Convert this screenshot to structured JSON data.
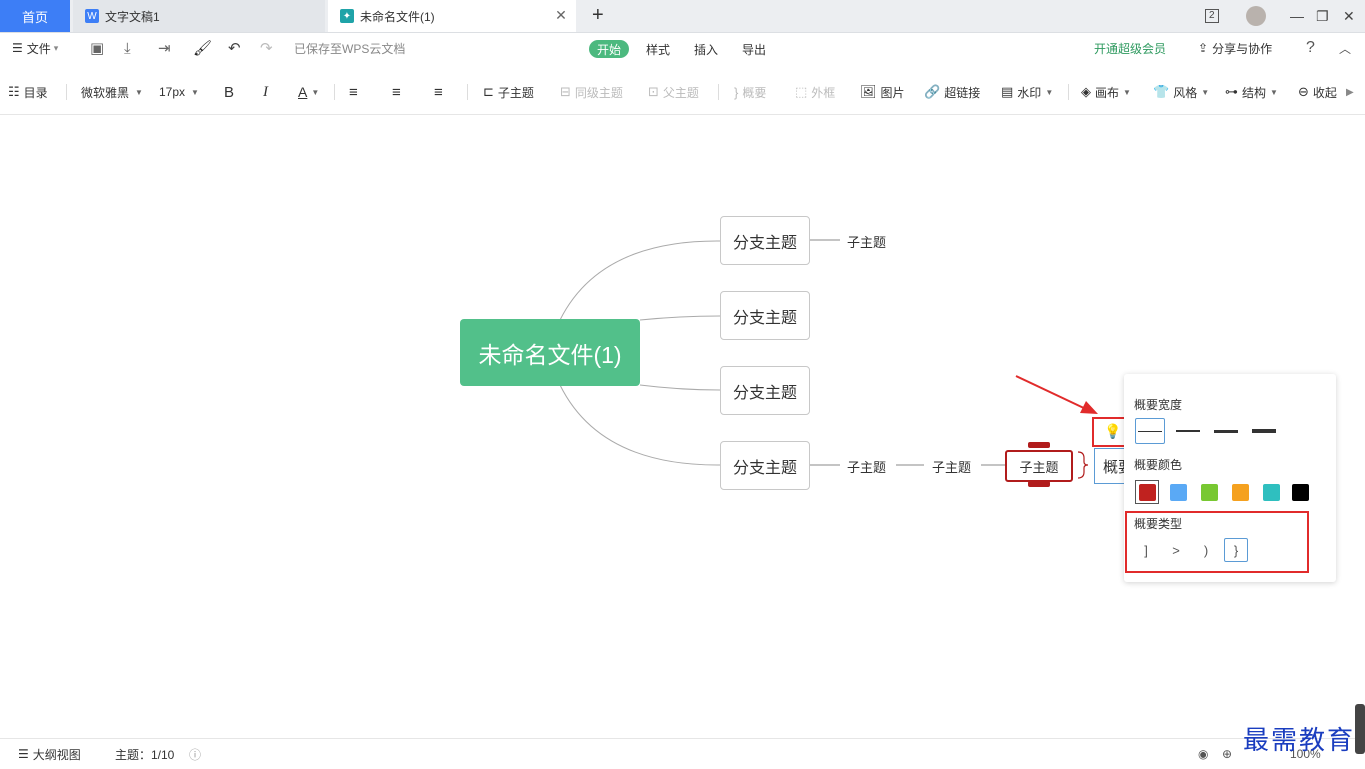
{
  "tabs": {
    "home": "首页",
    "doc1": "文字文稿1",
    "doc2": "未命名文件(1)",
    "badge": "2"
  },
  "menu": {
    "file": "文件",
    "saved_status": "已保存至WPS云文档",
    "tabs": [
      "开始",
      "样式",
      "插入",
      "导出"
    ],
    "vip": "开通超级会员",
    "share": "分享与协作"
  },
  "toolbar": {
    "outline": "目录",
    "font": "微软雅黑",
    "size": "17px",
    "bold": "B",
    "italic": "I",
    "color": "A",
    "child_topic": "子主题",
    "sibling_topic": "同级主题",
    "parent_topic": "父主题",
    "summary": "概要",
    "frame": "外框",
    "image": "图片",
    "hyperlink": "超链接",
    "watermark": "水印",
    "canvas": "画布",
    "style": "风格",
    "structure": "结构",
    "collapse": "收起"
  },
  "mindmap": {
    "root": "未命名文件(1)",
    "branches": [
      "分支主题",
      "分支主题",
      "分支主题",
      "分支主题"
    ],
    "sub1": "子主题",
    "sub4a": "子主题",
    "sub4b": "子主题",
    "sub4c": "子主题",
    "summary_node": "概要"
  },
  "popup": {
    "width_title": "概要宽度",
    "color_title": "概要颜色",
    "type_title": "概要类型",
    "colors": [
      "#c0221f",
      "#5aa9f5",
      "#78c832",
      "#f5a11f",
      "#2fbfbf",
      "#000000"
    ],
    "types": [
      "]",
      ">",
      ")",
      "}"
    ]
  },
  "status": {
    "outline_view": "大纲视图",
    "topic_count": "主题：1/10",
    "zoom": "100%"
  },
  "watermark_text": "最需教育"
}
